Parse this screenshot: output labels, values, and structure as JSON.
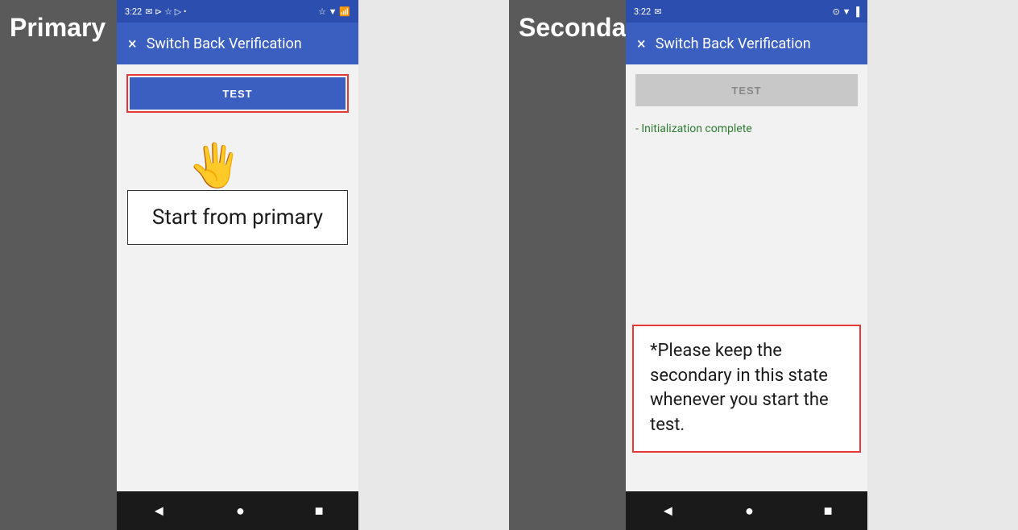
{
  "primary": {
    "label": "Primary",
    "statusBar": {
      "time": "3:22",
      "icons": "✉ ⊳ ☆ ▷ •"
    },
    "appBar": {
      "closeLabel": "×",
      "title": "Switch Back Verification"
    },
    "testButton": "TEST",
    "startFromPrimary": "Start from primary"
  },
  "secondary": {
    "label": "Secondary",
    "statusBar": {
      "time": "3:22",
      "icons": "⊙ ▼ ▐"
    },
    "appBar": {
      "closeLabel": "×",
      "title": "Switch Back Verification"
    },
    "testButton": "TEST",
    "initText": "- Initialization complete"
  },
  "noteBox": {
    "text": "*Please keep the secondary in this state whenever you start the test."
  },
  "navBar": {
    "back": "◄",
    "home": "●",
    "recent": "■"
  }
}
